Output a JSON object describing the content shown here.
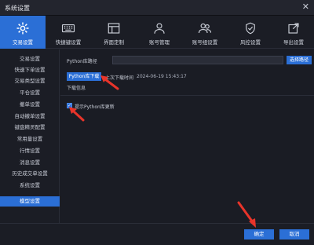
{
  "window": {
    "title": "系统设置",
    "close_glyph": "✕"
  },
  "toolbar": {
    "items": [
      {
        "label": "交易设置",
        "icon": "gear-icon",
        "active": true
      },
      {
        "label": "快捷键设置",
        "icon": "keyboard-icon",
        "active": false
      },
      {
        "label": "界面定制",
        "icon": "layout-icon",
        "active": false
      },
      {
        "label": "账号管理",
        "icon": "user-icon",
        "active": false
      },
      {
        "label": "账号组设置",
        "icon": "user-group-icon",
        "active": false
      },
      {
        "label": "风控设置",
        "icon": "shield-icon",
        "active": false
      },
      {
        "label": "导出设置",
        "icon": "export-icon",
        "active": false
      }
    ]
  },
  "sidebar": {
    "items": [
      {
        "label": "交易设置",
        "active": false
      },
      {
        "label": "快速下单设置",
        "active": false
      },
      {
        "label": "交易类型设置",
        "active": false
      },
      {
        "label": "平仓设置",
        "active": false
      },
      {
        "label": "撤单设置",
        "active": false
      },
      {
        "label": "自动撤单设置",
        "active": false
      },
      {
        "label": "键盘精灵配置",
        "active": false
      },
      {
        "label": "常用量设置",
        "active": false
      },
      {
        "label": "行情设置",
        "active": false
      },
      {
        "label": "消息设置",
        "active": false
      },
      {
        "label": "历史成交单设置",
        "active": false
      },
      {
        "label": "系统设置",
        "active": false
      },
      {
        "label": "模型设置",
        "active": true
      }
    ]
  },
  "main": {
    "path_label": "Python库路径",
    "path_value": "",
    "browse_label": "选择路径",
    "download_label": "Python库下载",
    "last_download_label": "上次下载时间",
    "last_download_time": "2024-06-19 15:43:17",
    "download_info_label": "下载信息",
    "prompt_update_label": "提示Python库更新",
    "prompt_update_checked": true,
    "check_glyph": "✓"
  },
  "footer": {
    "ok_label": "确定",
    "cancel_label": "取消"
  },
  "colors": {
    "accent": "#2b6fd6",
    "arrow": "#e8342a",
    "background": "#1a1c24"
  }
}
